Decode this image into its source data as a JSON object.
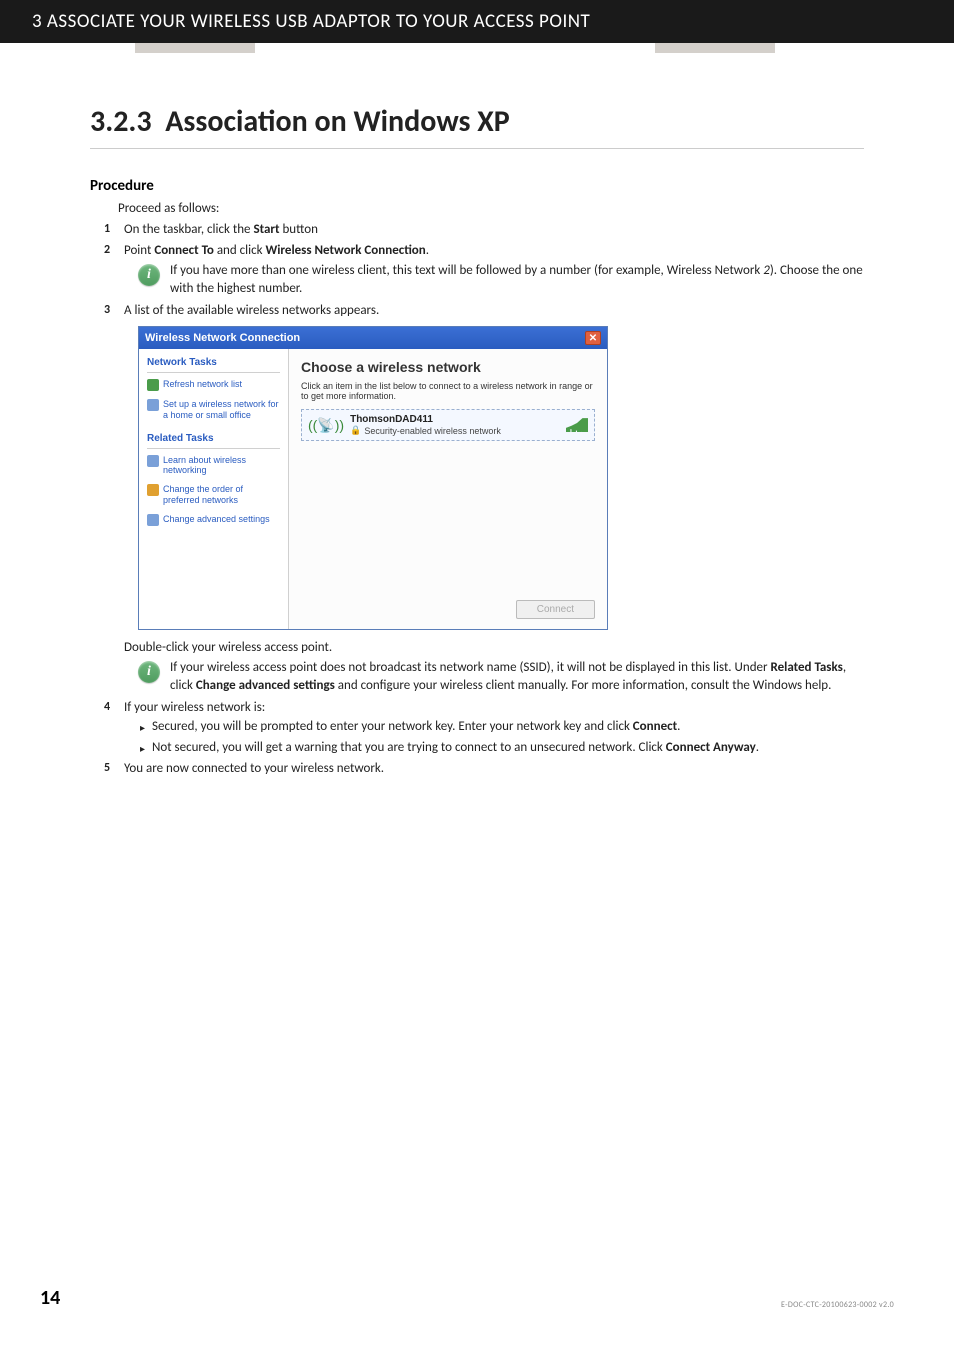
{
  "header": {
    "chapter": "3 ASSOCIATE YOUR WIRELESS USB ADAPTOR TO YOUR ACCESS POINT"
  },
  "section": {
    "number": "3.2.3",
    "title": "Association on Windows XP"
  },
  "procedure": {
    "heading": "Procedure",
    "intro": "Proceed as follows:",
    "step1_pre": "On the taskbar, click the ",
    "step1_bold": "Start",
    "step1_post": " button",
    "step2_pre": "Point ",
    "step2_b1": "Connect To",
    "step2_mid": " and click ",
    "step2_b2": "Wireless Network Connection",
    "step2_post": ".",
    "note1_pre": "If you have more than one wireless client, this text will be followed by a number (for example, Wireless Network ",
    "note1_num": "2",
    "note1_post": "). Choose the one with the highest number.",
    "step3": "A list of the available wireless networks appears.",
    "step3_after": "Double-click your wireless access point.",
    "note2_pre": "If your wireless access point does not broadcast its network name (SSID), it will not be displayed in this list. Under ",
    "note2_b1": "Related Tasks",
    "note2_mid1": ", click ",
    "note2_b2": "Change advanced settings",
    "note2_post": " and configure your wireless client manually. For more information, consult the Windows help.",
    "step4": "If your wireless network is:",
    "bullet1_pre": "Secured, you will be prompted to enter your network key. Enter your network key and click ",
    "bullet1_b": "Connect",
    "bullet1_post": ".",
    "bullet2_pre": "Not secured, you will get a warning that you are trying to connect to an unsecured network. Click ",
    "bullet2_b": "Connect Anyway",
    "bullet2_post": ".",
    "step5": "You are now connected to your wireless network."
  },
  "screenshot": {
    "title": "Wireless Network Connection",
    "side": {
      "head1": "Network Tasks",
      "link1": "Refresh network list",
      "link2": "Set up a wireless network for a home or small office",
      "head2": "Related Tasks",
      "link3": "Learn about wireless networking",
      "link4": "Change the order of preferred networks",
      "link5": "Change advanced settings"
    },
    "main": {
      "title": "Choose a wireless network",
      "sub": "Click an item in the list below to connect to a wireless network in range or to get more information.",
      "net_name": "ThomsonDAD411",
      "net_sec": "Security-enabled wireless network",
      "connect": "Connect"
    }
  },
  "footer": {
    "page": "14",
    "docid": "E-DOC-CTC-20100623-0002 v2.0"
  }
}
